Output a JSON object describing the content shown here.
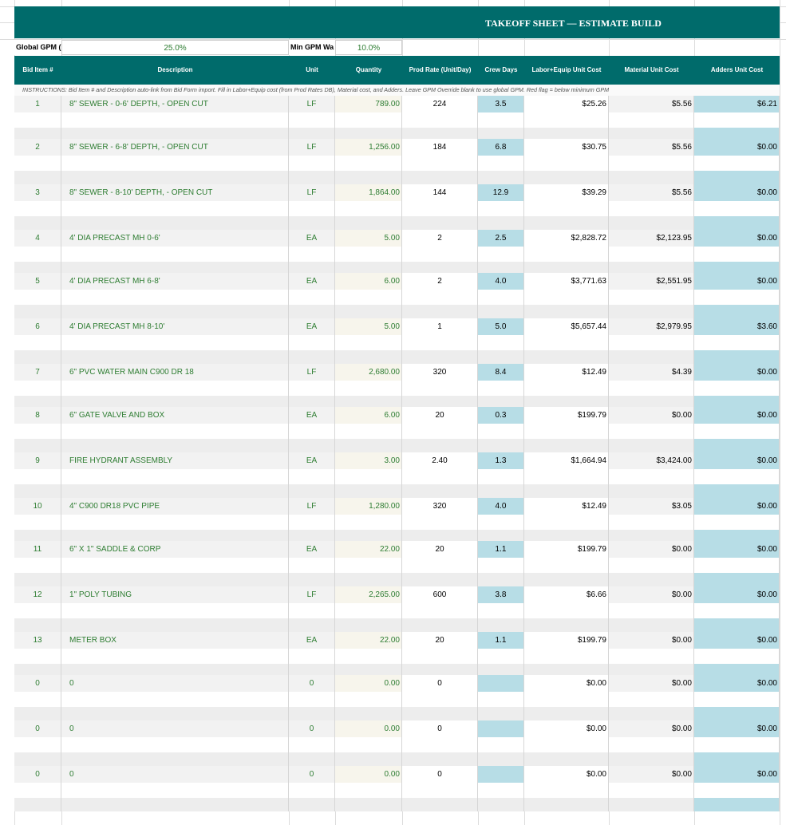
{
  "sheet": {
    "title": "TAKEOFF SHEET — ESTIMATE BUILD",
    "global_gpm_label": "Global GPM (",
    "global_gpm_value": "25.0%",
    "min_gpm_label": "Min GPM Wa",
    "min_gpm_value": "10.0%",
    "instructions": "INSTRUCTIONS: Bid Item # and Description auto-link from Bid Form import. Fill in Labor+Equip cost (from Prod Rates DB), Material cost, and Adders. Leave GPM Override blank to use global GPM. Red flag = below minimum GPM"
  },
  "columns": [
    "Bid Item #",
    "Description",
    "Unit",
    "Quantity",
    "Prod Rate (Unit/Day)",
    "Crew Days",
    "Labor+Equip Unit Cost",
    "Material Unit Cost",
    "Adders Unit Cost"
  ],
  "rows": [
    {
      "bid": "1",
      "desc": "8\" SEWER - 0-6' DEPTH, - OPEN CUT",
      "unit": "LF",
      "qty": "789.00",
      "rate": "224",
      "days": "3.5",
      "labor": "$25.26",
      "material": "$5.56",
      "adders": "$6.21"
    },
    {
      "bid": "2",
      "desc": "8\" SEWER - 6-8' DEPTH, - OPEN CUT",
      "unit": "LF",
      "qty": "1,256.00",
      "rate": "184",
      "days": "6.8",
      "labor": "$30.75",
      "material": "$5.56",
      "adders": "$0.00"
    },
    {
      "bid": "3",
      "desc": "8\" SEWER - 8-10' DEPTH, - OPEN CUT",
      "unit": "LF",
      "qty": "1,864.00",
      "rate": "144",
      "days": "12.9",
      "labor": "$39.29",
      "material": "$5.56",
      "adders": "$0.00"
    },
    {
      "bid": "4",
      "desc": "4' DIA PRECAST MH 0-6'",
      "unit": "EA",
      "qty": "5.00",
      "rate": "2",
      "days": "2.5",
      "labor": "$2,828.72",
      "material": "$2,123.95",
      "adders": "$0.00"
    },
    {
      "bid": "5",
      "desc": "4' DIA PRECAST MH 6-8'",
      "unit": "EA",
      "qty": "6.00",
      "rate": "2",
      "days": "4.0",
      "labor": "$3,771.63",
      "material": "$2,551.95",
      "adders": "$0.00"
    },
    {
      "bid": "6",
      "desc": "4' DIA PRECAST MH 8-10'",
      "unit": "EA",
      "qty": "5.00",
      "rate": "1",
      "days": "5.0",
      "labor": "$5,657.44",
      "material": "$2,979.95",
      "adders": "$3.60"
    },
    {
      "bid": "7",
      "desc": "6\" PVC WATER MAIN C900 DR 18",
      "unit": "LF",
      "qty": "2,680.00",
      "rate": "320",
      "days": "8.4",
      "labor": "$12.49",
      "material": "$4.39",
      "adders": "$0.00"
    },
    {
      "bid": "8",
      "desc": "6\" GATE VALVE AND BOX",
      "unit": "EA",
      "qty": "6.00",
      "rate": "20",
      "days": "0.3",
      "labor": "$199.79",
      "material": "$0.00",
      "adders": "$0.00"
    },
    {
      "bid": "9",
      "desc": "FIRE HYDRANT ASSEMBLY",
      "unit": "EA",
      "qty": "3.00",
      "rate": "2.40",
      "days": "1.3",
      "labor": "$1,664.94",
      "material": "$3,424.00",
      "adders": "$0.00"
    },
    {
      "bid": "10",
      "desc": "4\" C900 DR18 PVC PIPE",
      "unit": "LF",
      "qty": "1,280.00",
      "rate": "320",
      "days": "4.0",
      "labor": "$12.49",
      "material": "$3.05",
      "adders": "$0.00"
    },
    {
      "bid": "11",
      "desc": "6\" X 1\" SADDLE & CORP",
      "unit": "EA",
      "qty": "22.00",
      "rate": "20",
      "days": "1.1",
      "labor": "$199.79",
      "material": "$0.00",
      "adders": "$0.00"
    },
    {
      "bid": "12",
      "desc": "1\" POLY TUBING",
      "unit": "LF",
      "qty": "2,265.00",
      "rate": "600",
      "days": "3.8",
      "labor": "$6.66",
      "material": "$0.00",
      "adders": "$0.00"
    },
    {
      "bid": "13",
      "desc": "METER BOX",
      "unit": "EA",
      "qty": "22.00",
      "rate": "20",
      "days": "1.1",
      "labor": "$199.79",
      "material": "$0.00",
      "adders": "$0.00"
    },
    {
      "bid": "0",
      "desc": "0",
      "unit": "0",
      "qty": "0.00",
      "rate": "0",
      "days": "",
      "labor": "$0.00",
      "material": "$0.00",
      "adders": "$0.00"
    },
    {
      "bid": "0",
      "desc": "0",
      "unit": "0",
      "qty": "0.00",
      "rate": "0",
      "days": "",
      "labor": "$0.00",
      "material": "$0.00",
      "adders": "$0.00"
    },
    {
      "bid": "0",
      "desc": "0",
      "unit": "0",
      "qty": "0.00",
      "rate": "0",
      "days": "",
      "labor": "$0.00",
      "material": "$0.00",
      "adders": "$0.00"
    }
  ],
  "colors": {
    "header_bg": "#006b6b",
    "header_text": "#ffffff",
    "green_text": "#2e7d32",
    "crew_days_bg": "#b7dde6",
    "row_shade": "#f2f2f2"
  }
}
